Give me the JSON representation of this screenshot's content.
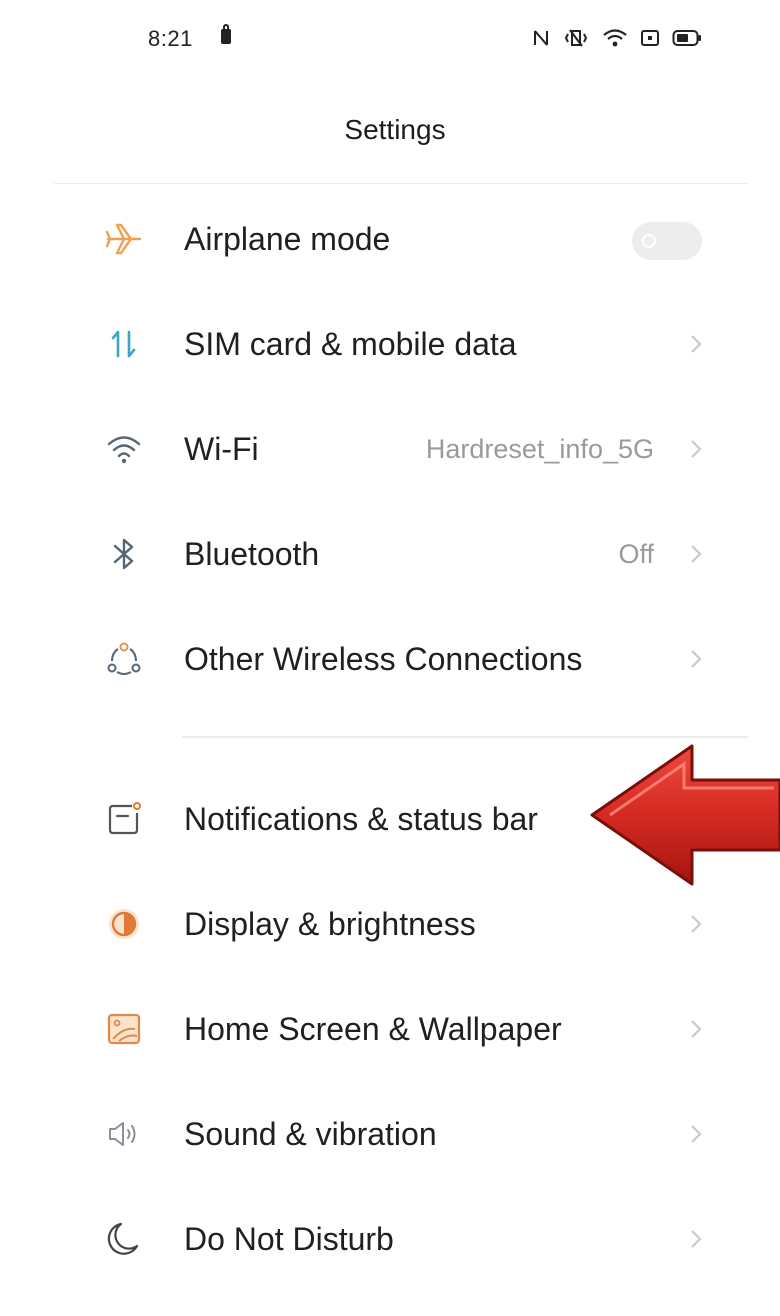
{
  "status_bar": {
    "time": "8:21",
    "icons": [
      "nfc-icon",
      "vibrate-icon",
      "wifi-icon",
      "screen-icon",
      "battery-icon"
    ]
  },
  "header": {
    "title": "Settings"
  },
  "sections": [
    {
      "items": [
        {
          "label": "Airplane mode",
          "icon": "airplane-icon",
          "icon_color": "#f0a050",
          "control": "toggle",
          "toggle_on": false
        },
        {
          "label": "SIM card & mobile data",
          "icon": "data-arrows-icon",
          "icon_color": "#3aa8c1",
          "control": "chevron"
        },
        {
          "label": "Wi-Fi",
          "value": "Hardreset_info_5G",
          "icon": "wifi-icon",
          "icon_color": "#556677",
          "control": "chevron"
        },
        {
          "label": "Bluetooth",
          "value": "Off",
          "icon": "bluetooth-icon",
          "icon_color": "#556677",
          "control": "chevron"
        },
        {
          "label": "Other Wireless Connections",
          "icon": "wireless-connections-icon",
          "icon_color": "#d79a4e",
          "control": "chevron"
        }
      ]
    },
    {
      "items": [
        {
          "label": "Notifications & status bar",
          "icon": "notification-icon",
          "icon_color": "#555555",
          "control": "chevron"
        },
        {
          "label": "Display & brightness",
          "icon": "brightness-icon",
          "icon_color": "#f0a050",
          "control": "chevron"
        },
        {
          "label": "Home Screen & Wallpaper",
          "icon": "wallpaper-icon",
          "icon_color": "#e08a4a",
          "control": "chevron"
        },
        {
          "label": "Sound & vibration",
          "icon": "sound-icon",
          "icon_color": "#8a9099",
          "control": "chevron"
        },
        {
          "label": "Do Not Disturb",
          "icon": "moon-icon",
          "icon_color": "#444444",
          "control": "chevron"
        }
      ]
    }
  ],
  "annotation": {
    "type": "arrow-pointer",
    "color": "#d42a22",
    "points_to": "Notifications & status bar"
  }
}
